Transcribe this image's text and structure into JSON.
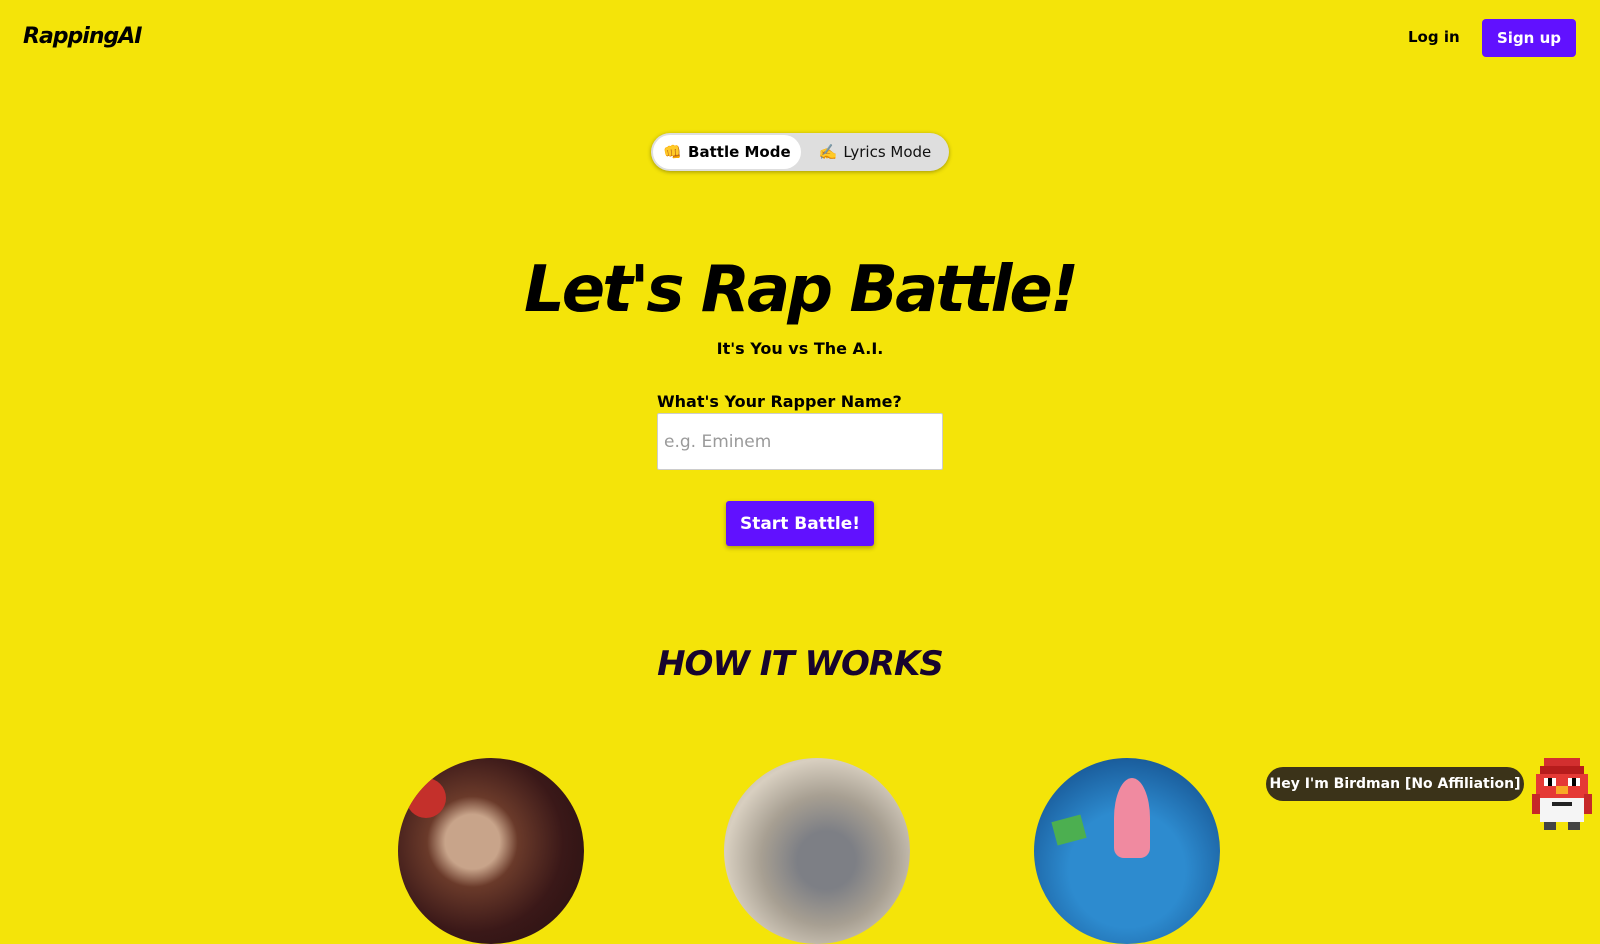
{
  "header": {
    "logo": "RappingAI",
    "login_label": "Log in",
    "signup_label": "Sign up"
  },
  "mode_toggle": {
    "tabs": [
      {
        "emoji": "👊",
        "label": "Battle Mode",
        "selected": true
      },
      {
        "emoji": "✍️",
        "label": "Lyrics Mode",
        "selected": false
      }
    ]
  },
  "hero": {
    "title": "Let's Rap Battle!",
    "subtitle": "It's You vs The A.I."
  },
  "form": {
    "name_label": "What's Your Rapper Name?",
    "name_placeholder": "e.g. Eminem",
    "name_value": "",
    "start_label": "Start Battle!"
  },
  "how_it_works": {
    "heading": "HOW IT WORKS"
  },
  "chat_widget": {
    "bubble_text": "Hey I'm Birdman [No Affiliation]"
  },
  "colors": {
    "background": "#f4e409",
    "accent": "#6111ff",
    "bubble": "#3b3319"
  }
}
